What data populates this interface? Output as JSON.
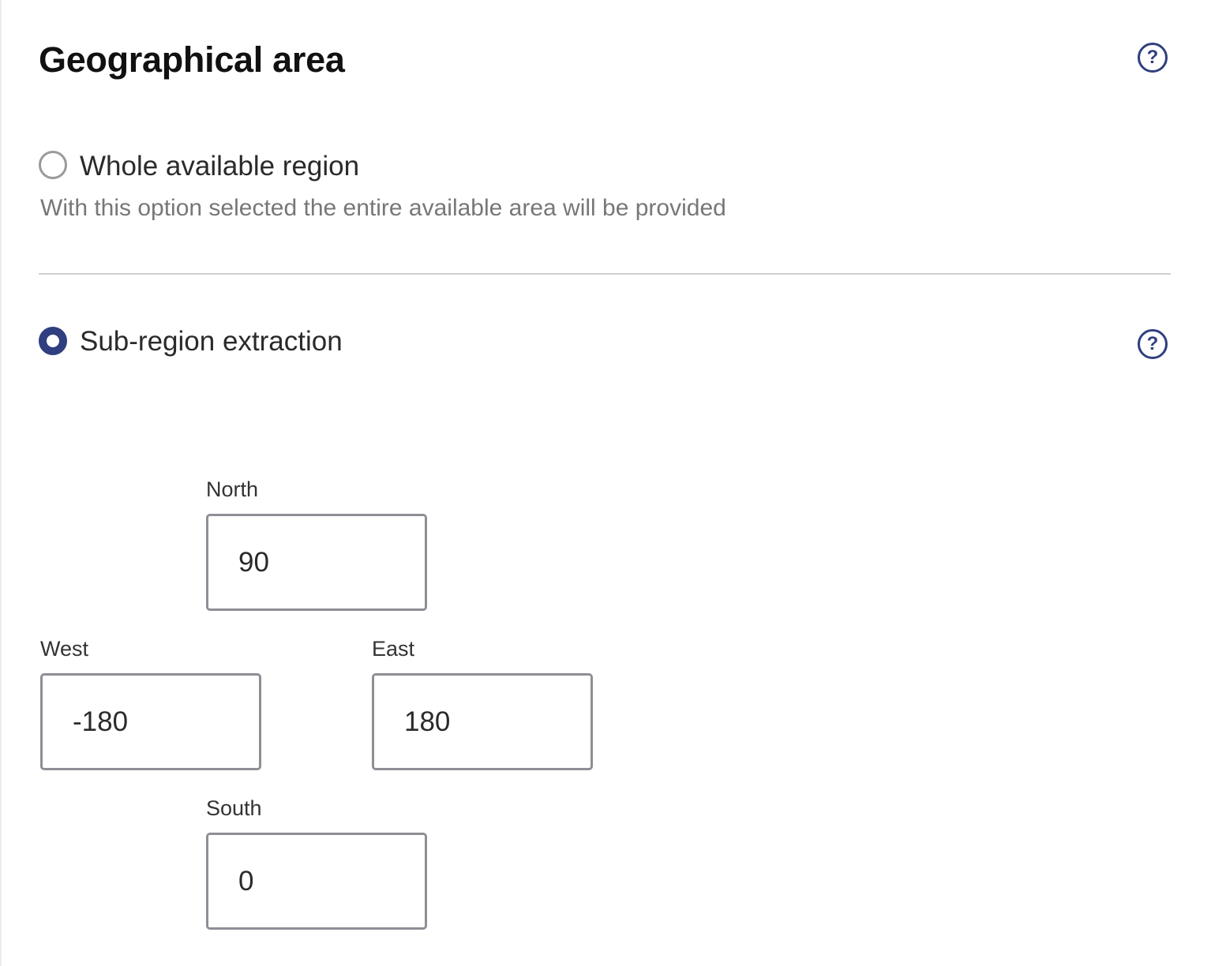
{
  "section": {
    "title": "Geographical area",
    "help_icon": "question-circle-icon"
  },
  "options": {
    "whole": {
      "label": "Whole available region",
      "description": "With this option selected the entire available area will be provided",
      "selected": false
    },
    "subregion": {
      "label": "Sub-region extraction",
      "selected": true,
      "help_icon": "question-circle-icon"
    }
  },
  "coordinates": {
    "north": {
      "label": "North",
      "value": "90"
    },
    "west": {
      "label": "West",
      "value": "-180"
    },
    "east": {
      "label": "East",
      "value": "180"
    },
    "south": {
      "label": "South",
      "value": "0"
    }
  },
  "colors": {
    "accent": "#2f3f7f",
    "border": "#8e8e96",
    "muted_text": "#777777",
    "divider": "#cfcfcf"
  }
}
